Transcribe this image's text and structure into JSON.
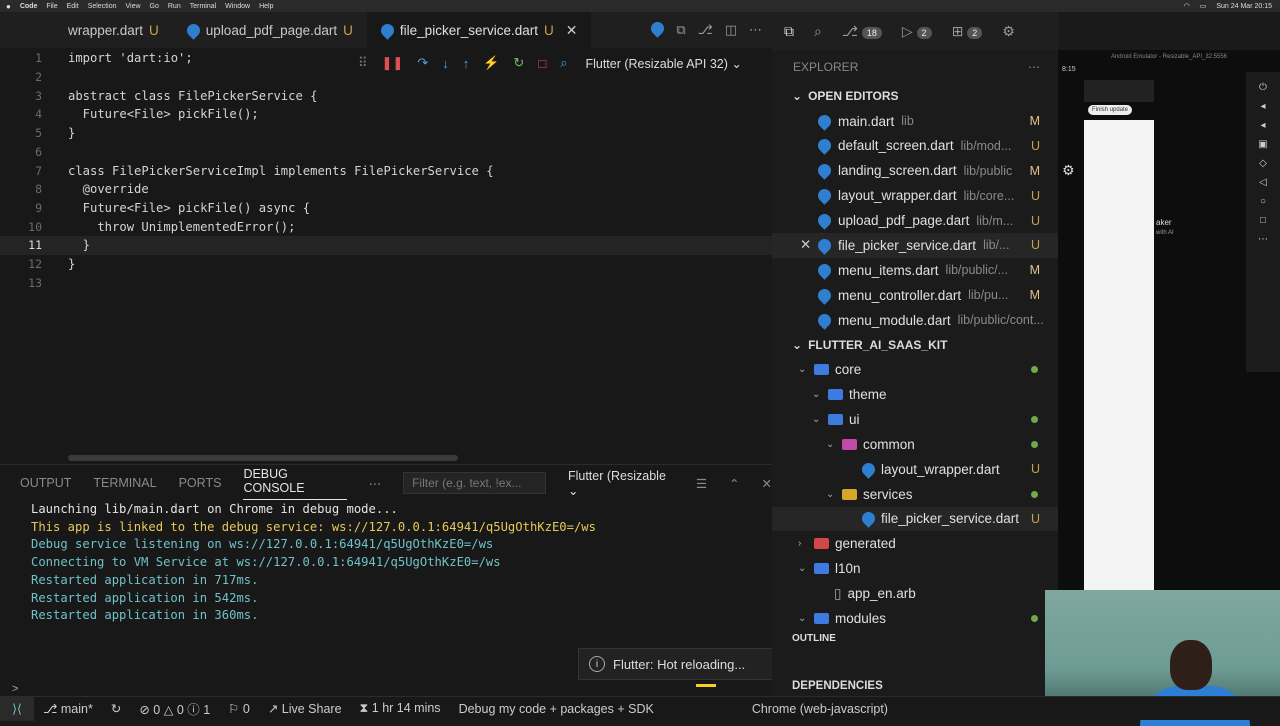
{
  "menubar": {
    "app": "Code",
    "items": [
      "File",
      "Edit",
      "Selection",
      "View",
      "Go",
      "Run",
      "Terminal",
      "Window",
      "Help"
    ],
    "clock": "Sun 24 Mar 20:15"
  },
  "tabs": [
    {
      "name": "wrapper.dart",
      "status": "U"
    },
    {
      "name": "upload_pdf_page.dart",
      "status": "U"
    },
    {
      "name": "file_picker_service.dart",
      "status": "U",
      "active": true
    }
  ],
  "debug_toolbar": {
    "device": "Flutter (Resizable API 32)"
  },
  "editor": {
    "lines": [
      {
        "n": "1",
        "code": "import 'dart:io';"
      },
      {
        "n": "2",
        "code": ""
      },
      {
        "n": "3",
        "code": "abstract class FilePickerService {"
      },
      {
        "n": "4",
        "code": "  Future<File> pickFile();"
      },
      {
        "n": "5",
        "code": "}"
      },
      {
        "n": "6",
        "code": ""
      },
      {
        "n": "7",
        "code": "class FilePickerServiceImpl implements FilePickerService {"
      },
      {
        "n": "8",
        "code": "  @override"
      },
      {
        "n": "9",
        "code": "  Future<File> pickFile() async {"
      },
      {
        "n": "10",
        "code": "    throw UnimplementedError();"
      },
      {
        "n": "11",
        "code": "  }"
      },
      {
        "n": "12",
        "code": "}"
      },
      {
        "n": "13",
        "code": ""
      }
    ]
  },
  "panel": {
    "tabs": [
      "OUTPUT",
      "TERMINAL",
      "PORTS",
      "DEBUG CONSOLE"
    ],
    "filter_placeholder": "Filter (e.g. text, !ex...",
    "session": "Flutter (Resizable",
    "console": [
      {
        "text": "Launching lib/main.dart on Chrome in debug mode...",
        "cls": "c1"
      },
      {
        "text": "This app is linked to the debug service: ws://127.0.0.1:64941/q5UgOthKzE0=/ws",
        "cls": "c2"
      },
      {
        "text": "Debug service listening on ws://127.0.0.1:64941/q5UgOthKzE0=/ws",
        "cls": "c3"
      },
      {
        "text": "Connecting to VM Service at ws://127.0.0.1:64941/q5UgOthKzE0=/ws",
        "cls": "c3"
      },
      {
        "text": "Restarted application in 717ms.",
        "cls": "c3"
      },
      {
        "text": "Restarted application in 542ms.",
        "cls": "c3"
      },
      {
        "text": "Restarted application in 360ms.",
        "cls": "c3"
      }
    ]
  },
  "toast": {
    "text": "Flutter: Hot reloading..."
  },
  "activity": {
    "badge1": "18",
    "badge2": "2",
    "badge3": "2"
  },
  "explorer": {
    "title": "EXPLORER",
    "open_editors_header": "OPEN EDITORS",
    "open_editors": [
      {
        "name": "main.dart",
        "path": "lib",
        "status": "M"
      },
      {
        "name": "default_screen.dart",
        "path": "lib/mod...",
        "status": "U"
      },
      {
        "name": "landing_screen.dart",
        "path": "lib/public",
        "status": "M"
      },
      {
        "name": "layout_wrapper.dart",
        "path": "lib/core...",
        "status": "U"
      },
      {
        "name": "upload_pdf_page.dart",
        "path": "lib/m...",
        "status": "U"
      },
      {
        "name": "file_picker_service.dart",
        "path": "lib/...",
        "status": "U",
        "active": true
      },
      {
        "name": "menu_items.dart",
        "path": "lib/public/...",
        "status": "M"
      },
      {
        "name": "menu_controller.dart",
        "path": "lib/pu...",
        "status": "M"
      },
      {
        "name": "menu_module.dart",
        "path": "lib/public/cont...",
        "status": ""
      }
    ],
    "project_header": "FLUTTER_AI_SAAS_KIT",
    "tree": [
      {
        "name": "core",
        "indent": 0,
        "chev": "⌄",
        "folder": "blue",
        "dot": true
      },
      {
        "name": "theme",
        "indent": 1,
        "chev": "⌄",
        "folder": "blue",
        "dot": false
      },
      {
        "name": "ui",
        "indent": 1,
        "chev": "⌄",
        "folder": "blue",
        "dot": true
      },
      {
        "name": "common",
        "indent": 2,
        "chev": "⌄",
        "folder": "pink",
        "dot": true
      },
      {
        "name": "layout_wrapper.dart",
        "indent": 3,
        "file": true,
        "status": "U"
      },
      {
        "name": "services",
        "indent": 2,
        "chev": "⌄",
        "folder": "yel",
        "dot": true
      },
      {
        "name": "file_picker_service.dart",
        "indent": 3,
        "file": true,
        "status": "U",
        "active": true
      },
      {
        "name": "generated",
        "indent": 0,
        "chev": "›",
        "folder": "red",
        "dot": false
      },
      {
        "name": "l10n",
        "indent": 0,
        "chev": "⌄",
        "folder": "blue",
        "dot": false
      },
      {
        "name": "app_en.arb",
        "indent": 1,
        "arb": true
      },
      {
        "name": "modules",
        "indent": 0,
        "chev": "⌄",
        "folder": "blue",
        "dot": true
      }
    ],
    "outline": "OUTLINE",
    "dependencies": "DEPENDENCIES"
  },
  "emulator": {
    "title": "Android Emulator - Resizable_API_32:5556",
    "time": "8:15",
    "button": "Finish update",
    "text1": "aker",
    "text2": "with AI"
  },
  "statusbar": {
    "branch": "main*",
    "errors": "0",
    "warnings": "0",
    "info": "1",
    "ports": "0",
    "liveshare": "Live Share",
    "time": "1 hr 14 mins",
    "debug": "Debug my code + packages + SDK",
    "device": "Chrome (web-javascript)"
  },
  "colors": {
    "accent": "#2f7fd0",
    "untracked": "#c8a24a",
    "modified": "#e2c08d",
    "folder_dot": "#73a84a"
  }
}
